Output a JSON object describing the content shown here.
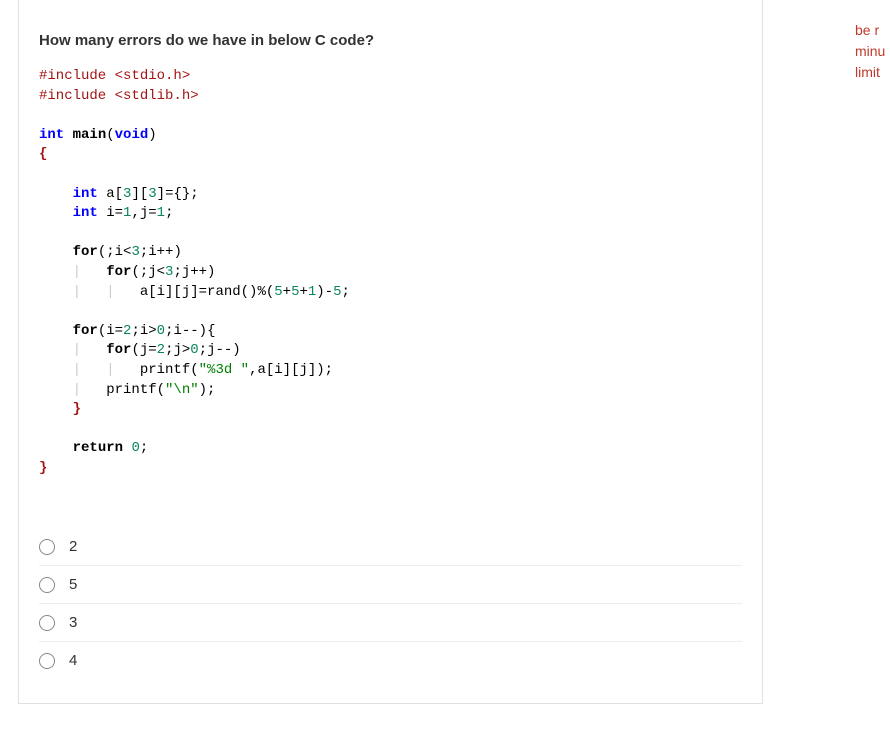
{
  "question": {
    "title": "How many errors do we have in below C code?",
    "code": {
      "line1a": "#include",
      "line1b": " <stdio.h>",
      "line2a": "#include",
      "line2b": " <stdlib.h>",
      "line3_int": "int",
      "line3_main": " main",
      "line3_open": "(",
      "line3_void": "void",
      "line3_close": ")",
      "line4": "{",
      "line5_int": "int",
      "line5_rest": " a[",
      "line5_n1": "3",
      "line5_mid1": "][",
      "line5_n2": "3",
      "line5_mid2": "]={};",
      "line6_int": "int",
      "line6_rest": " i=",
      "line6_n1": "1",
      "line6_mid": ",j=",
      "line6_n2": "1",
      "line6_end": ";",
      "line7_for": "for",
      "line7_rest": "(;i<",
      "line7_n": "3",
      "line7_end": ";i++)",
      "line8_for": "for",
      "line8_rest": "(;j<",
      "line8_n": "3",
      "line8_end": ";j++)",
      "line9_a": "a[i][j]=rand()%(",
      "line9_n1": "5",
      "line9_plus1": "+",
      "line9_n2": "5",
      "line9_plus2": "+",
      "line9_n3": "1",
      "line9_minus": ")-",
      "line9_n4": "5",
      "line9_end": ";",
      "line10_for": "for",
      "line10_rest": "(i=",
      "line10_n1": "2",
      "line10_mid": ";i>",
      "line10_n2": "0",
      "line10_end": ";i--){",
      "line11_for": "for",
      "line11_rest": "(j=",
      "line11_n1": "2",
      "line11_mid": ";j>",
      "line11_n2": "0",
      "line11_end": ";j--)",
      "line12_printf": "printf(",
      "line12_str": "\"%3d \"",
      "line12_rest": ",a[i][j]);",
      "line13_printf": "printf(",
      "line13_str": "\"\\n\"",
      "line13_rest": ");",
      "line14": "}",
      "line15_return": "return",
      "line15_sp": " ",
      "line15_n": "0",
      "line15_end": ";",
      "line16": "}"
    },
    "options": [
      {
        "label": "2"
      },
      {
        "label": "5"
      },
      {
        "label": "3"
      },
      {
        "label": "4"
      }
    ]
  },
  "sidebar": {
    "line1": "be r",
    "line2": "minu",
    "line3": "limit"
  }
}
